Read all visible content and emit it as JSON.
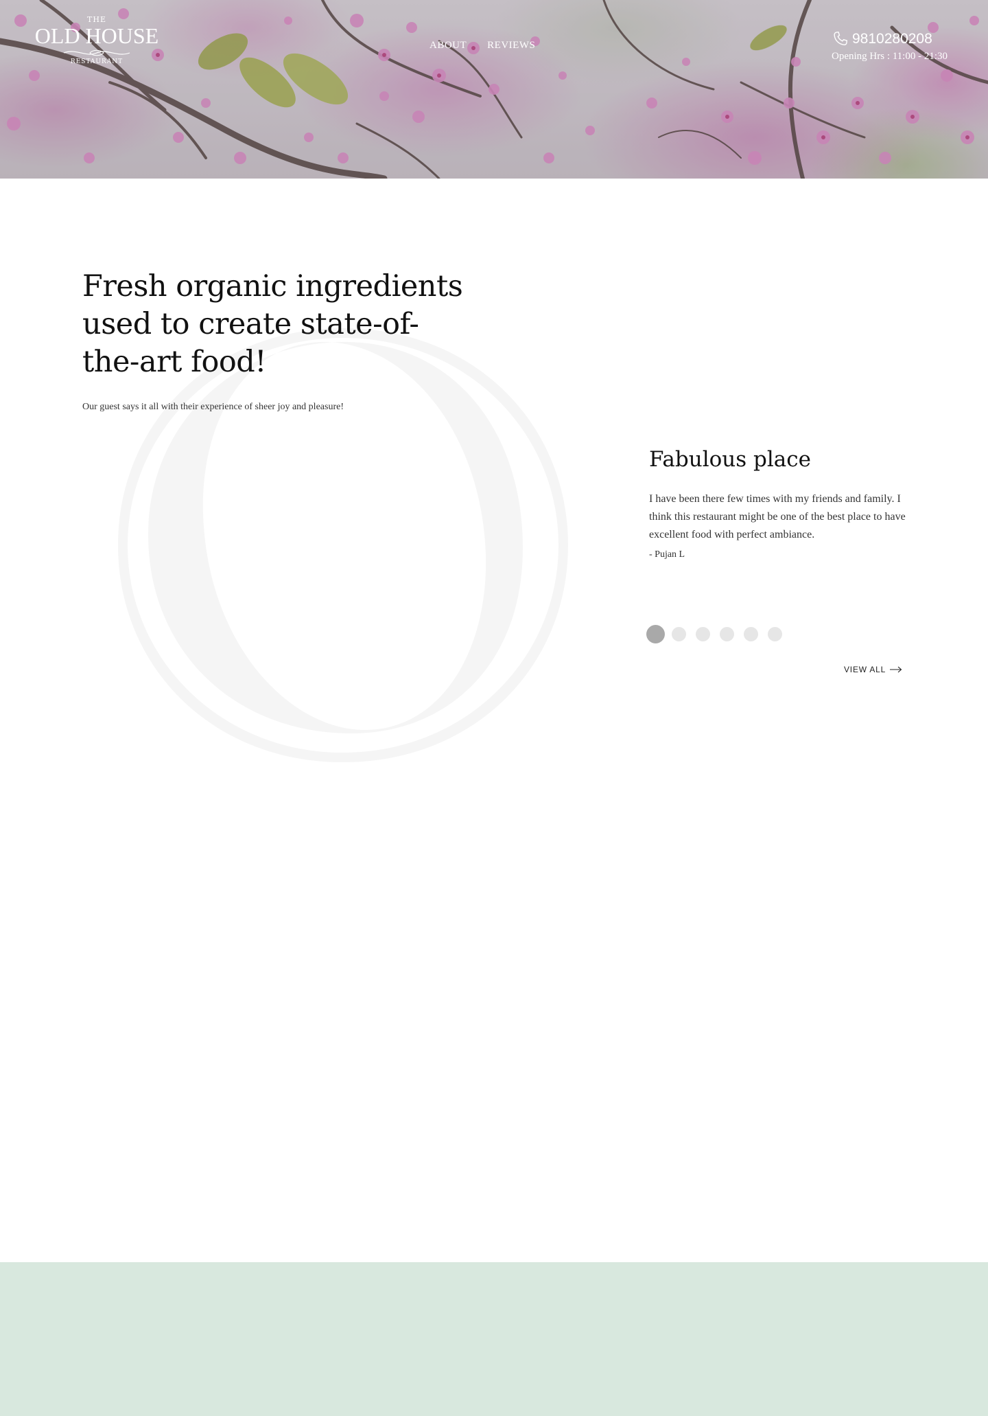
{
  "header": {
    "logo": {
      "top_text": "THE",
      "name": "OLD HOUSE",
      "bottom_text": "RESTAURANT"
    },
    "nav": [
      {
        "label": "ABOUT"
      },
      {
        "label": "REVIEWS"
      }
    ],
    "phone": "9810280208",
    "opening_hours": "Opening Hrs : 11:00 - 21:30"
  },
  "intro": {
    "heading": "Fresh organic ingredients used to create state-of-the-art food!",
    "subtext": "Our guest says it all with their experience of sheer joy and pleasure!"
  },
  "review": {
    "title": "Fabulous place",
    "text": "I have been there few times with my friends and family. I think this restaurant might be one of the best place to have excellent food with perfect ambiance.",
    "author": "- Pujan L",
    "slide_count": 6,
    "active_slide": 1
  },
  "view_all": {
    "label": "VIEW ALL"
  },
  "colors": {
    "footer_band": "#d8e8de",
    "dot_active": "#a9a9a9",
    "dot_inactive": "#e6e6e6",
    "watermark": "#f5f5f5"
  },
  "icons": {
    "phone": "phone-icon",
    "arrow": "arrow-right-icon",
    "logo_flourish": "flourish-ornament"
  }
}
